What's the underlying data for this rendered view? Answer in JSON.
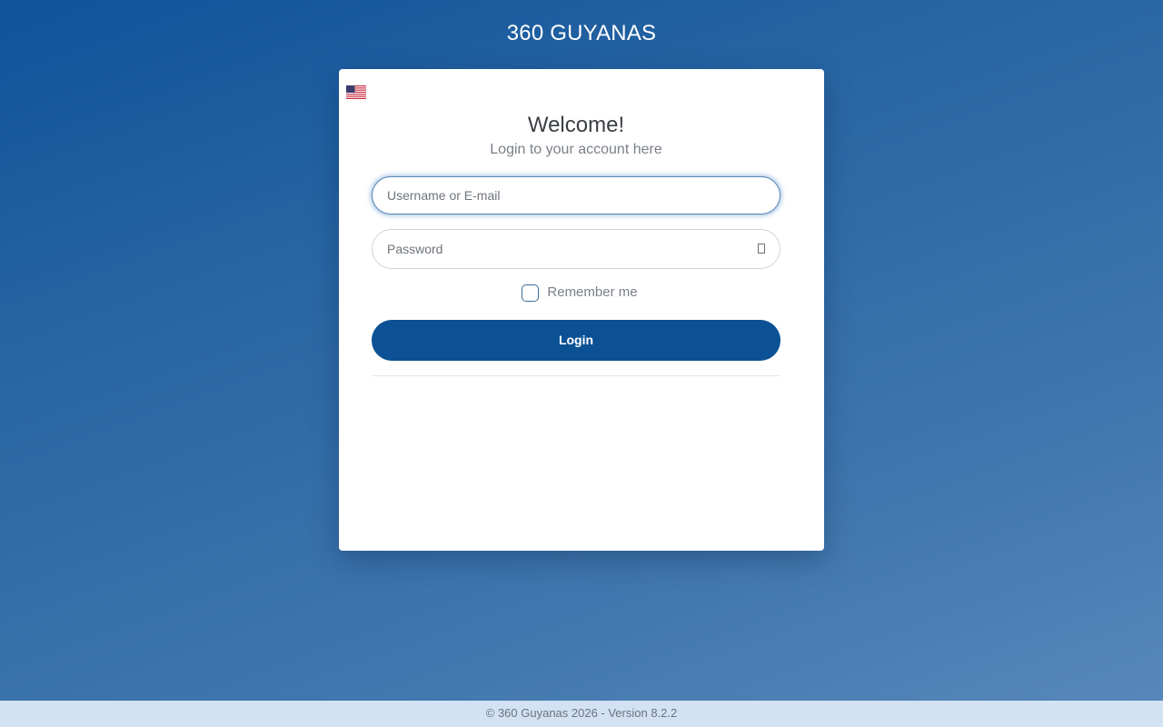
{
  "header": {
    "app_title": "360 GUYANAS"
  },
  "language": {
    "selected": "English (US)",
    "icon": "us-flag-icon"
  },
  "login_card": {
    "welcome": "Welcome!",
    "subtitle": "Login to your account here",
    "username": {
      "placeholder": "Username or E-mail",
      "value": ""
    },
    "password": {
      "placeholder": "Password",
      "value": "",
      "toggle_icon": "eye-icon"
    },
    "remember_me": {
      "label": "Remember me",
      "checked": false
    },
    "login_label": "Login"
  },
  "footer": {
    "text": "© 360 Guyanas 2026 - Version 8.2.2"
  },
  "colors": {
    "primary": "#0b5194",
    "background_start": "#0f539a",
    "background_end": "#5889bb",
    "footer_bg": "#d3e2f2"
  }
}
